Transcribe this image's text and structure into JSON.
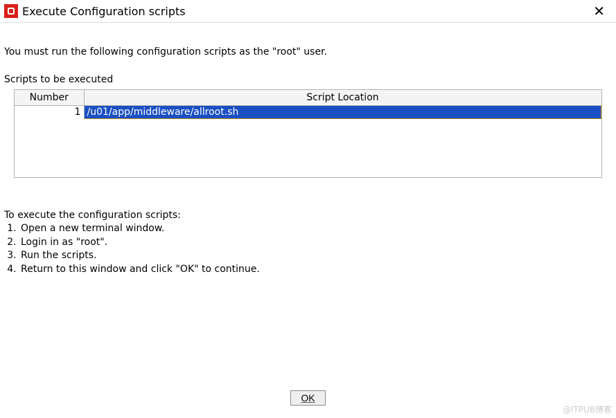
{
  "window": {
    "title": "Execute Configuration scripts"
  },
  "message": "You must run the following configuration scripts as the \"root\" user.",
  "scripts_label": "Scripts to be executed",
  "table": {
    "headers": {
      "number": "Number",
      "location": "Script Location"
    },
    "rows": [
      {
        "number": "1",
        "location": "/u01/app/middleware/allroot.sh"
      }
    ]
  },
  "instructions": {
    "title": "To execute the configuration scripts:",
    "steps": [
      "Open a new  terminal window.",
      "Login in as \"root\".",
      "Run the scripts.",
      "Return to this window and click \"OK\" to continue."
    ]
  },
  "buttons": {
    "ok": "OK"
  },
  "watermark": "@ITPUB博客"
}
